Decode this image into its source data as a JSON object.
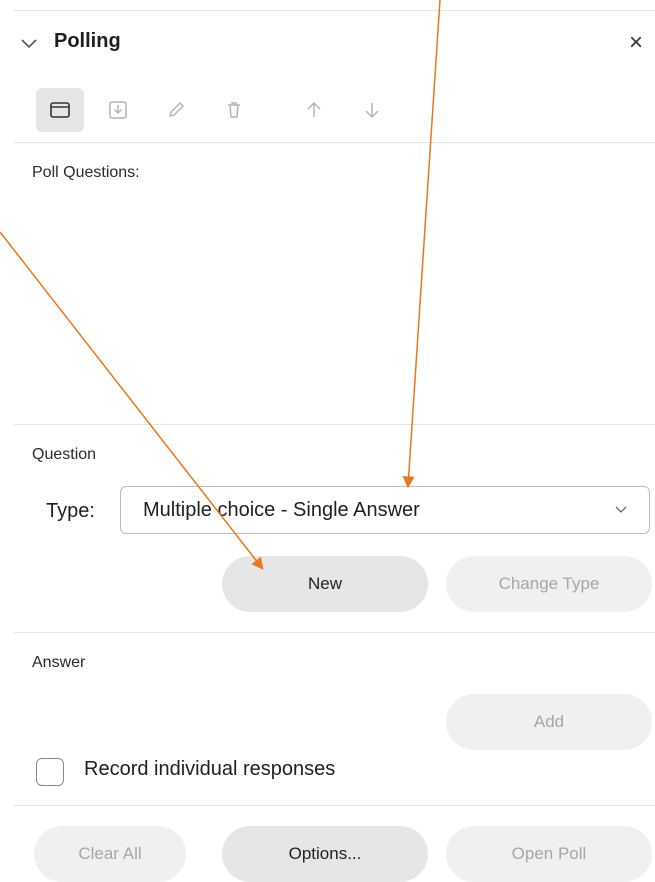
{
  "panel": {
    "title": "Polling",
    "close_glyph": "×"
  },
  "toolbar": {
    "buttons": [
      {
        "name": "open-folder-icon",
        "state": "active"
      },
      {
        "name": "save-download-icon",
        "state": "disabled"
      },
      {
        "name": "edit-pencil-icon",
        "state": "disabled"
      },
      {
        "name": "delete-trash-icon",
        "state": "disabled"
      },
      {
        "name": "move-up-arrow-icon",
        "state": "disabled"
      },
      {
        "name": "move-down-arrow-icon",
        "state": "disabled"
      }
    ]
  },
  "questions_section": {
    "label": "Poll Questions:"
  },
  "question_section": {
    "label": "Question",
    "type_label": "Type:",
    "type_value": "Multiple choice - Single Answer",
    "new_label": "New",
    "change_type_label": "Change Type"
  },
  "answer_section": {
    "label": "Answer",
    "add_label": "Add",
    "record_label": "Record individual responses",
    "record_checked": false
  },
  "footer": {
    "clear_all_label": "Clear All",
    "options_label": "Options...",
    "open_poll_label": "Open Poll"
  },
  "colors": {
    "annotation_arrow": "#e8781e",
    "button_bg": "#e6e6e6",
    "disabled_text": "#a6a6a6"
  }
}
